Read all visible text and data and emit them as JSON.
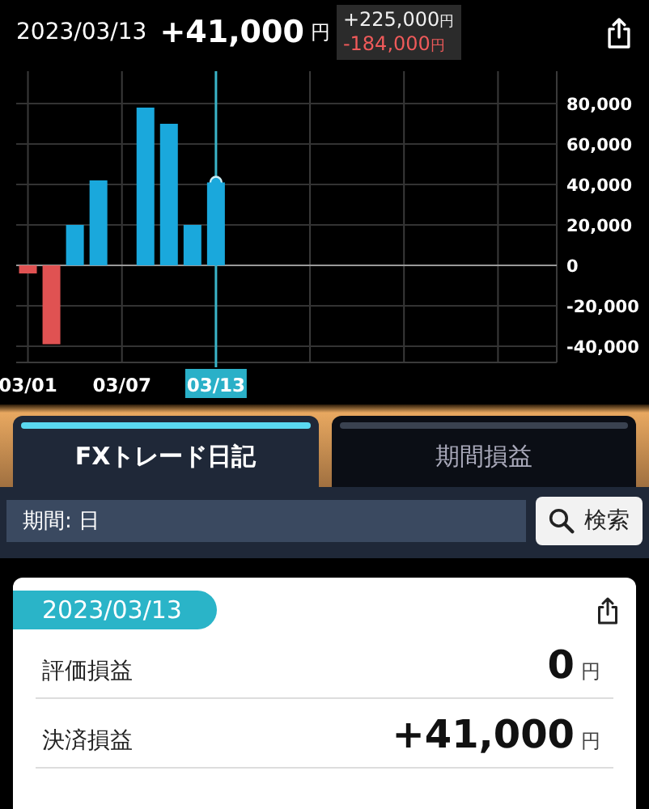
{
  "header": {
    "date": "2023/03/13",
    "pnl": "+41,000",
    "unit": "円",
    "breakdown": [
      {
        "kind": "gain",
        "amount": "+225,000",
        "unit": "円"
      },
      {
        "kind": "loss",
        "amount": "-184,000",
        "unit": "円"
      }
    ]
  },
  "chart": {
    "chart_data": {
      "type": "bar",
      "categories": [
        "03/01",
        null,
        null,
        null,
        "03/07",
        null,
        null,
        null,
        "03/13",
        null,
        null,
        null,
        null,
        null,
        null,
        null,
        null,
        null,
        null,
        null,
        null,
        null,
        null
      ],
      "series": [
        {
          "color": "#1aa8dc",
          "values": [
            null,
            null,
            20000,
            42000,
            null,
            78000,
            70000,
            20000,
            41000,
            null,
            null,
            null,
            null,
            null,
            null,
            null,
            null,
            null,
            null,
            null,
            null,
            null,
            null
          ]
        },
        {
          "color": "#e05252",
          "values": [
            -4000,
            -39000,
            null,
            null,
            null,
            null,
            null,
            null,
            null,
            null,
            null,
            null,
            null,
            null,
            null,
            null,
            null,
            null,
            null,
            null,
            null,
            null,
            null
          ]
        }
      ],
      "grid": true,
      "ylim": [
        -48000,
        96000
      ],
      "yticks": [
        {
          "value": 80000,
          "label": "80,000"
        },
        {
          "value": 60000,
          "label": "60,000"
        },
        {
          "value": 40000,
          "label": "40,000"
        },
        {
          "value": 20000,
          "label": "20,000"
        },
        {
          "value": 0,
          "label": "0"
        },
        {
          "value": -20000,
          "label": "-20,000"
        },
        {
          "value": -40000,
          "label": "-40,000"
        }
      ]
    }
  },
  "tabs": [
    {
      "label": "FXトレード日記",
      "selected": true
    },
    {
      "label": "期間損益",
      "selected": false
    }
  ],
  "search": {
    "value": "期間: 日",
    "button": "検索"
  },
  "card": {
    "date": "2023/03/13",
    "rows": [
      {
        "label": "評価損益",
        "value": "0",
        "unit": "円"
      },
      {
        "label": "決済損益",
        "value": "+41,000",
        "unit": "円"
      }
    ]
  }
}
